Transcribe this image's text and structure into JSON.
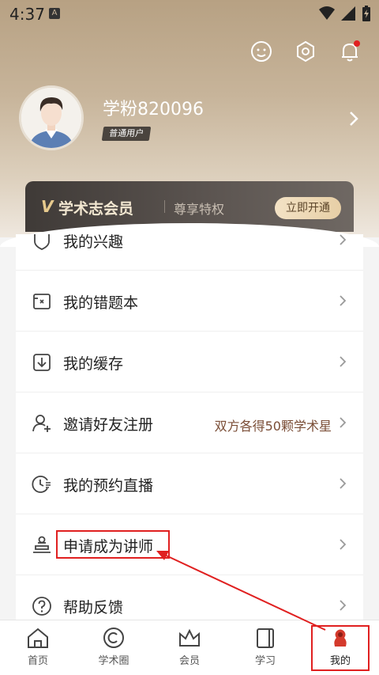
{
  "status": {
    "time": "4:37",
    "notification_glyph": "A"
  },
  "profile": {
    "username": "学粉820096",
    "badge": "普通用户"
  },
  "vip": {
    "logo": "V",
    "title": "学术志会员",
    "subtitle": "尊享特权",
    "button": "立即开通"
  },
  "menu": [
    {
      "label": "我的兴趣",
      "icon": "heart-shield-icon"
    },
    {
      "label": "我的错题本",
      "icon": "wrongbook-icon"
    },
    {
      "label": "我的缓存",
      "icon": "download-icon"
    },
    {
      "label": "邀请好友注册",
      "icon": "invite-user-icon",
      "extra": "双方各得50颗学术星"
    },
    {
      "label": "我的预约直播",
      "icon": "clock-list-icon"
    },
    {
      "label": "申请成为讲师",
      "icon": "lecturer-icon"
    },
    {
      "label": "帮助反馈",
      "icon": "help-icon"
    }
  ],
  "tabs": [
    {
      "label": "首页",
      "icon": "home-icon"
    },
    {
      "label": "学术圈",
      "icon": "circle-icon"
    },
    {
      "label": "会员",
      "icon": "crown-icon"
    },
    {
      "label": "学习",
      "icon": "book-icon"
    },
    {
      "label": "我的",
      "icon": "profile-icon"
    }
  ],
  "colors": {
    "accent_red": "#e02020",
    "vip_gold": "#e6c98d",
    "header_tan": "#c7b49a"
  }
}
